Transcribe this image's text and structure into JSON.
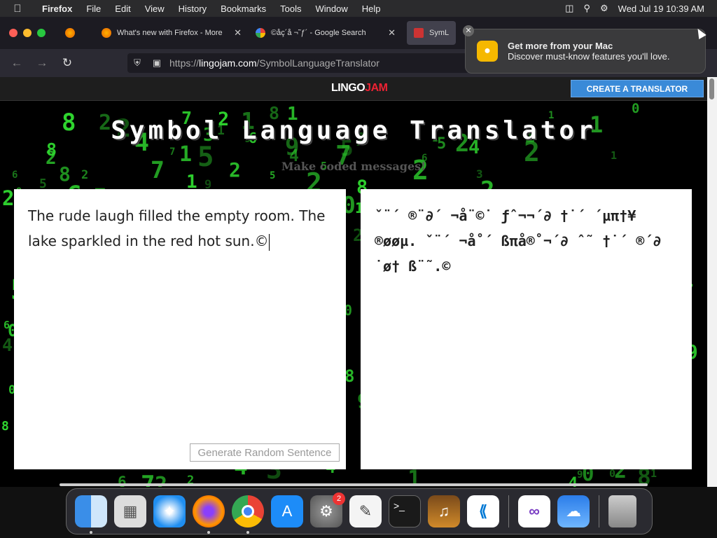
{
  "menubar": {
    "app_name": "Firefox",
    "items": [
      "File",
      "Edit",
      "View",
      "History",
      "Bookmarks",
      "Tools",
      "Window",
      "Help"
    ],
    "clock": "Wed Jul 19  10:39 AM"
  },
  "tabs": [
    {
      "label": "What's new with Firefox - More",
      "active": false
    },
    {
      "label": "©åç´å ¬˜ƒ´ - Google Search",
      "active": false
    },
    {
      "label": "SymL",
      "active": true
    }
  ],
  "url": {
    "prefix": "https://",
    "domain": "lingojam.com",
    "path": "/SymbolLanguageTranslator"
  },
  "notification": {
    "title": "Get more from your Mac",
    "body": "Discover must-know features you'll love."
  },
  "site": {
    "logo_part1": "LINGO",
    "logo_part2": "JAM",
    "create_button": "CREATE A TRANSLATOR",
    "title": "Symbol Language Translator",
    "subtitle": "Make coded messages!",
    "input_text": "The rude laugh filled the empty room. The lake sparkled in the red hot sun.©",
    "output_text": "ˇ¨´ ®¨∂´ ¬å¨©˙ ƒˆ¬¬´∂ †˙´ ´µπ†¥ ®øøµ. ˇ¨´ ¬å˚´ ßπå®˚¬´∂ ˆ˜ †˙´ ®´∂ ˙ø† ß¨˜.©",
    "generate_button": "Generate Random Sentence"
  },
  "dock": {
    "apps": [
      "finder",
      "launchpad",
      "safari",
      "firefox",
      "chrome",
      "app-store",
      "system-settings",
      "textedit",
      "terminal",
      "garageband",
      "vscode",
      "visual-studio",
      "weather",
      "trash"
    ],
    "settings_badge": "2"
  },
  "colors": {
    "accent": "#3a8ad8",
    "matrix_green": "#2fd62f",
    "logo_red": "#e23"
  }
}
